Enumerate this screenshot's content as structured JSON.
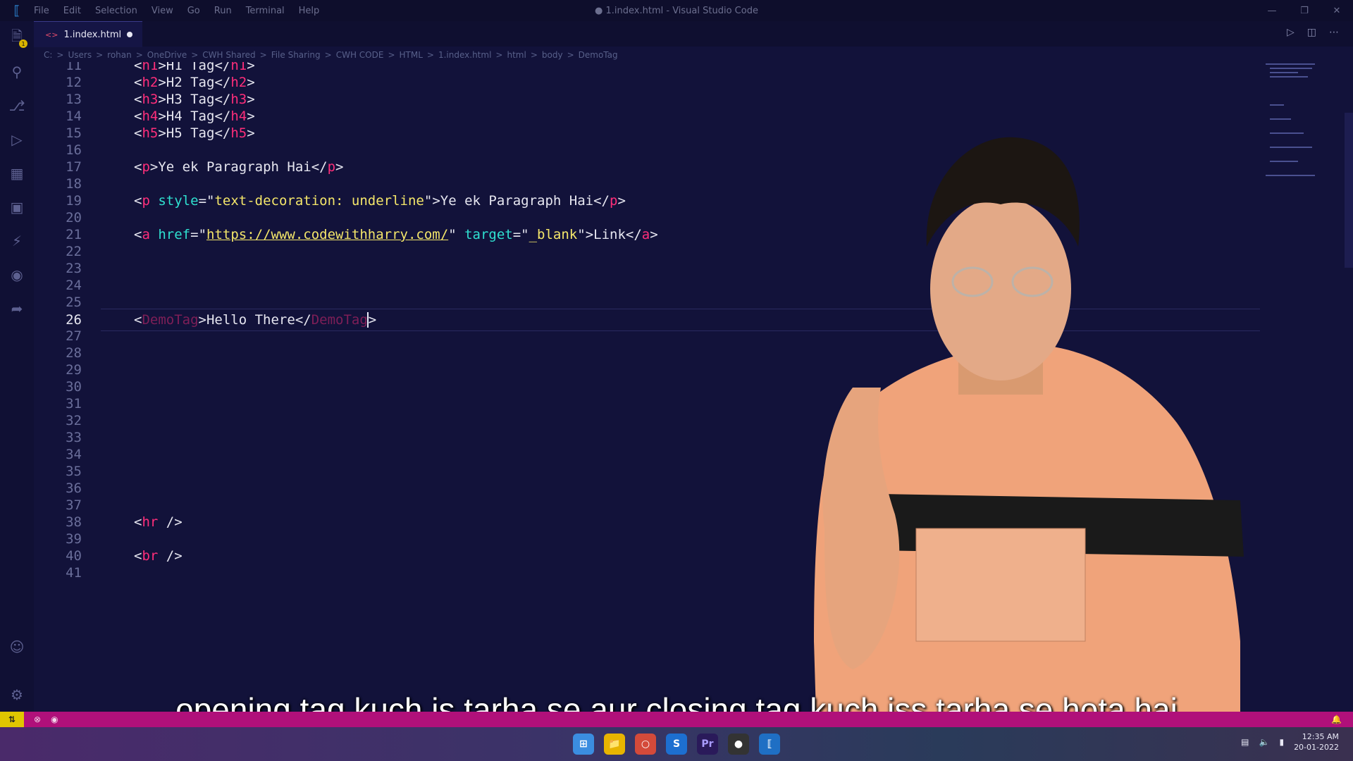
{
  "titlebar": {
    "menu": [
      "File",
      "Edit",
      "Selection",
      "View",
      "Go",
      "Run",
      "Terminal",
      "Help"
    ],
    "window_title": "● 1.index.html - Visual Studio Code"
  },
  "activity": {
    "badge": "1"
  },
  "tab": {
    "label": "1.index.html"
  },
  "breadcrumb": [
    "C:",
    "Users",
    "rohan",
    "OneDrive",
    "CWH Shared",
    "File Sharing",
    "CWH CODE",
    "HTML",
    "1.index.html",
    "html",
    "body",
    "DemoTag"
  ],
  "code_lines": [
    {
      "n": "11"
    },
    {
      "n": "12"
    },
    {
      "n": "13"
    },
    {
      "n": "14"
    },
    {
      "n": "15"
    },
    {
      "n": "16"
    },
    {
      "n": "17"
    },
    {
      "n": "18"
    },
    {
      "n": "19"
    },
    {
      "n": "20"
    },
    {
      "n": "21"
    },
    {
      "n": "22"
    },
    {
      "n": "23"
    },
    {
      "n": "24"
    },
    {
      "n": "25"
    },
    {
      "n": "26"
    },
    {
      "n": "27"
    },
    {
      "n": "28"
    },
    {
      "n": "29"
    },
    {
      "n": "30"
    },
    {
      "n": "31"
    },
    {
      "n": "32"
    },
    {
      "n": "33"
    },
    {
      "n": "34"
    },
    {
      "n": "35"
    },
    {
      "n": "36"
    },
    {
      "n": "37"
    },
    {
      "n": "38"
    },
    {
      "n": "39"
    },
    {
      "n": "40"
    },
    {
      "n": "41"
    }
  ],
  "code": {
    "h1_text": "H1 Tag",
    "h2_text": "H2 Tag",
    "h3_text": "H3 Tag",
    "h4_text": "H4 Tag",
    "h5_text": "H5 Tag",
    "p_text": "Ye ek Paragraph Hai",
    "style_attr_value": "text-decoration: underline",
    "href_value": "https://www.codewithharry.com/",
    "target_value": "_blank",
    "link_text": "Link",
    "demo_tag": "DemoTag",
    "demo_text": "Hello There"
  },
  "caption": "opening tag kuch is tarha se aur closing tag kuch iss tarha se hota hai",
  "clock": {
    "time": "12:35 AM",
    "date": "20-01-2022"
  },
  "colors": {
    "tag": "#ff2e7a",
    "attr": "#2fe0d0",
    "string": "#f4e66a",
    "background": "#12123a",
    "statusbar": "#b0107a"
  }
}
